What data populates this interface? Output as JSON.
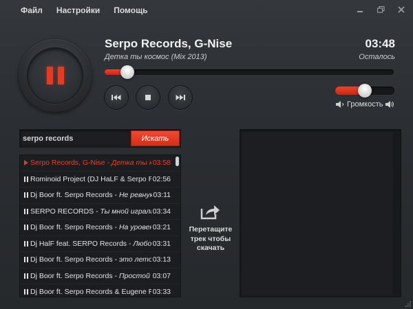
{
  "menu": {
    "file": "Файл",
    "settings": "Настройки",
    "help": "Помощь"
  },
  "window": {
    "minimize_icon": "minimize-icon",
    "maximize_icon": "maximize-icon",
    "close_icon": "close-icon"
  },
  "player": {
    "state_icon": "pause-icon",
    "artist": "Serpo Records, G-Nise",
    "title": "Детка ты космос (Mix 2013)",
    "time": "03:48",
    "remaining_label": "Осталось",
    "progress": 0.06,
    "volume": 0.5,
    "volume_label": "Громкость"
  },
  "search": {
    "value": "serpo records",
    "button_label": "Искать"
  },
  "playlist": [
    {
      "artist": "Serpo Records, G-Nise - ",
      "title": "Детка ты кос...",
      "duration": "03:58",
      "active": true
    },
    {
      "artist": "Rominoid Project (DJ HaLF & Serpo Re...",
      "title": "",
      "duration": "02:56",
      "active": false
    },
    {
      "artist": "Dj Boor ft. Serpo Records - ",
      "title": "Не ревную...",
      "duration": "03:11",
      "active": false
    },
    {
      "artist": "SERPO RECORDS - ",
      "title": "Ты мной играла, а...",
      "duration": "03:34",
      "active": false
    },
    {
      "artist": "Dj Boor ft. Serpo Records - ",
      "title": "На уровень...",
      "duration": "03:21",
      "active": false
    },
    {
      "artist": "Dj HalF feat. SERPO Records - ",
      "title": "Любовь...",
      "duration": "03:31",
      "active": false
    },
    {
      "artist": "Dj Boor ft. Serpo Records - ",
      "title": "это лето те...",
      "duration": "03:13",
      "active": false
    },
    {
      "artist": "Dj Boor ft. Serpo Records - ",
      "title": "Простой м...",
      "duration": "03:07",
      "active": false
    },
    {
      "artist": "Dj Boor ft. Serpo Records & Eugene Ra...",
      "title": "",
      "duration": "03:33",
      "active": false
    }
  ],
  "drop_zone": {
    "line1": "Перетащите",
    "line2": "трек чтобы",
    "line3": "скачать"
  },
  "colors": {
    "accent": "#e53a23",
    "background": "#2b2e32",
    "panel": "#1c1e21"
  }
}
